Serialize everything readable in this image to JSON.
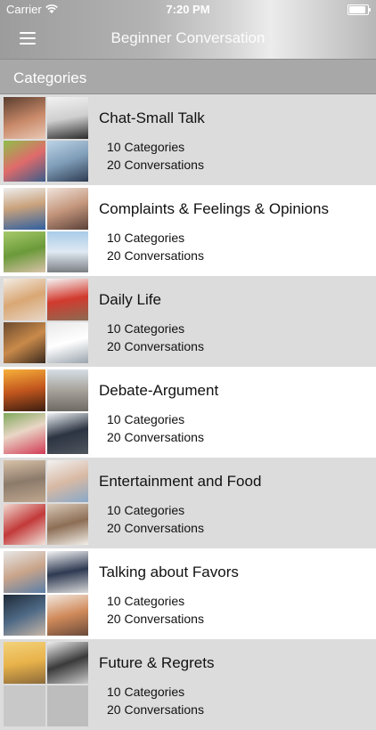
{
  "status_bar": {
    "carrier": "Carrier",
    "time": "7:20 PM"
  },
  "nav": {
    "title": "Beginner Conversation"
  },
  "section": {
    "title": "Categories"
  },
  "rows": [
    {
      "title": "Chat-Small Talk",
      "categories": "10 Categories",
      "conversations": "20 Conversations"
    },
    {
      "title": "Complaints & Feelings & Opinions",
      "categories": "10 Categories",
      "conversations": "20 Conversations"
    },
    {
      "title": "Daily Life",
      "categories": "10 Categories",
      "conversations": "20 Conversations"
    },
    {
      "title": "Debate-Argument",
      "categories": "10 Categories",
      "conversations": "20 Conversations"
    },
    {
      "title": "Entertainment and Food",
      "categories": "10 Categories",
      "conversations": "20 Conversations"
    },
    {
      "title": "Talking about Favors",
      "categories": "10 Categories",
      "conversations": "20 Conversations"
    },
    {
      "title": "Future & Regrets",
      "categories": "10 Categories",
      "conversations": "20 Conversations"
    }
  ]
}
